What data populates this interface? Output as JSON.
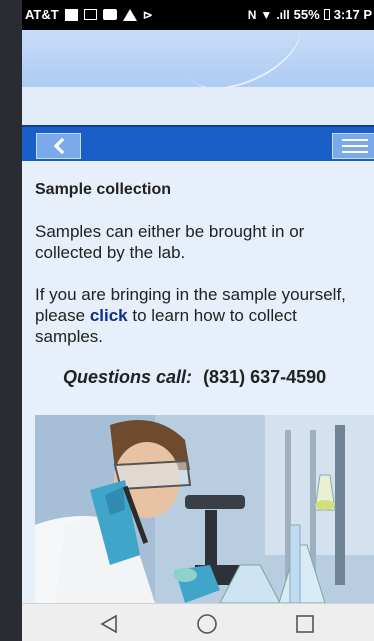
{
  "status_bar": {
    "carrier": "AT&T",
    "battery": "55%",
    "time": "3:17 P"
  },
  "nav": {
    "back_icon": "chevron-left-icon",
    "menu_icon": "hamburger-menu-icon"
  },
  "content": {
    "heading": "Sample collection",
    "para1_line1": "Samples can either be brought in or",
    "para1_line2": "collected by the lab.",
    "para2_line1": "If you are bringing in the sample yourself,",
    "para2_before_link": "please ",
    "para2_link": "click",
    "para2_after_link": " to learn how to collect",
    "para2_line3": "samples.",
    "questions_label": "Questions call:",
    "phone": "(831) 637-4590"
  },
  "photo": {
    "alt_icon": "scientist-lab-photo"
  },
  "system_nav": {
    "back_icon": "triangle-back-icon",
    "home_icon": "circle-home-icon",
    "recents_icon": "square-recents-icon"
  },
  "colors": {
    "nav_blue": "#1a5fc8",
    "link": "#0d2f8a",
    "background": "#e6effa"
  }
}
